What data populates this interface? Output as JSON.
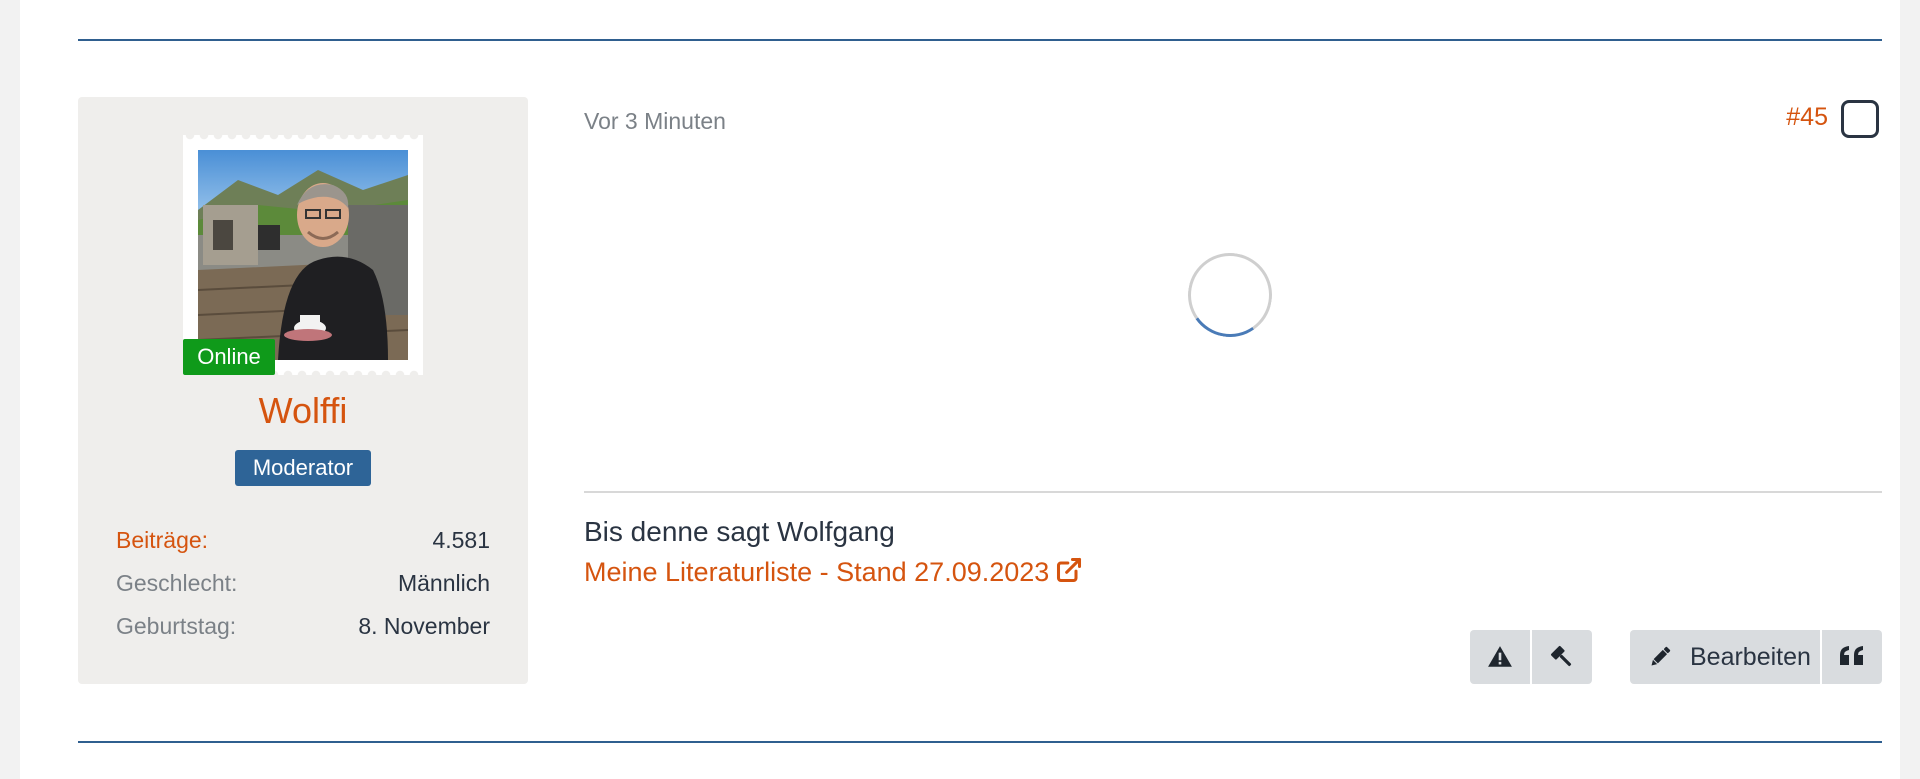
{
  "author": {
    "name": "Wolffi",
    "status": "Online",
    "rank": "Moderator",
    "stats": [
      {
        "label": "Beiträge:",
        "value": "4.581"
      },
      {
        "label": "Geschlecht:",
        "value": "Männlich"
      },
      {
        "label": "Geburtstag:",
        "value": "8. November"
      }
    ]
  },
  "post": {
    "timestamp": "Vor 3 Minuten",
    "number": "#45",
    "content_state": "loading"
  },
  "signature": {
    "text": "Bis denne sagt Wolfgang",
    "link_text": "Meine Literaturliste - Stand 27.09.2023"
  },
  "actions": {
    "report_icon": "warning-icon",
    "moderate_icon": "gavel-icon",
    "edit_label": "Bearbeiten",
    "edit_icon": "pencil-icon",
    "quote_icon": "quote-icon"
  },
  "colors": {
    "accent": "#d5540f",
    "online": "#0f9a1a",
    "rank": "#2e6497",
    "divider": "#2f5f8f",
    "sidebar_bg": "#efeeec",
    "button_bg": "#d9dcdf"
  }
}
